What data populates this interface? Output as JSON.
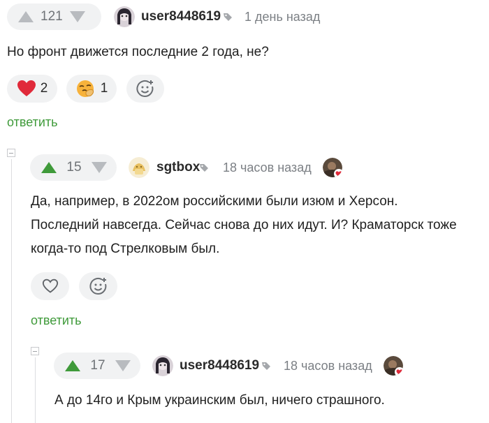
{
  "comments": [
    {
      "votes": "121",
      "username": "user8448619",
      "time": "1 день назад",
      "lines": [
        "Но фронт движется последние 2 года, не?"
      ],
      "reactions": [
        {
          "icon": "heart-icon",
          "count": "2"
        },
        {
          "icon": "face-with-hand-emoji-icon",
          "count": "1"
        }
      ],
      "reply_label": "ответить"
    },
    {
      "votes": "15",
      "username": "sgtbox",
      "time": "18 часов назад",
      "lines": [
        "Да, например, в 2022ом российскими были изюм и Херсон.",
        "Последний навсегда. Сейчас снова до них идут. И? Краматорск тоже",
        "когда-то под Стрелковым был."
      ],
      "reply_label": "ответить"
    },
    {
      "votes": "17",
      "username": "user8448619",
      "time": "18 часов назад",
      "lines": [
        "А до 14го и Крым украинским был, ничего страшного."
      ]
    }
  ],
  "colors": {
    "upvote": "#3f9a3a",
    "neutral_arrow": "#b8bbbf",
    "reply": "#3f9a3a",
    "heart": "#e02a3a"
  }
}
